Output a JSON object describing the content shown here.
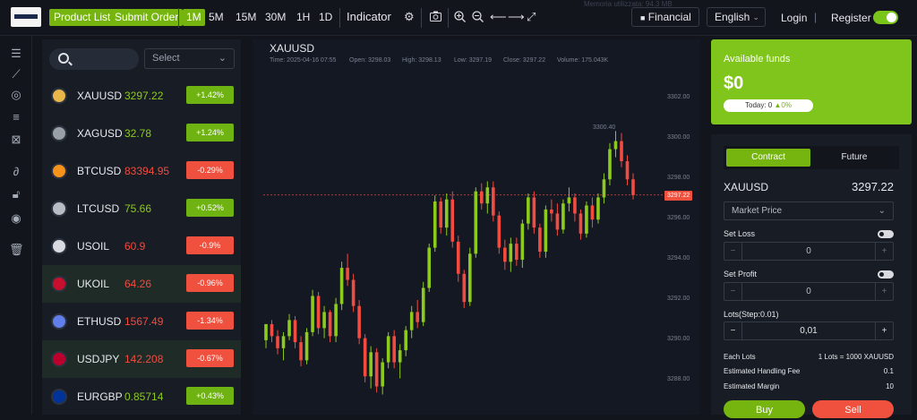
{
  "topbar": {
    "product_list": "Product List",
    "submit_order": "Submit Order",
    "timeframes": [
      "1M",
      "5M",
      "15M",
      "30M",
      "1H",
      "1D"
    ],
    "indicator": "Indicator",
    "memory": "Memoria utilizzata: 94.3 MB",
    "financial": "Financial",
    "language": "English",
    "login": "Login",
    "divider": "|",
    "register": "Register"
  },
  "watchlist": {
    "select_placeholder": "Select",
    "items": [
      {
        "symbol": "XAUUSD",
        "price": "3297.22",
        "change": "+1.42%",
        "dir": "up"
      },
      {
        "symbol": "XAGUSD",
        "price": "32.78",
        "change": "+1.24%",
        "dir": "up"
      },
      {
        "symbol": "BTCUSD",
        "price": "83394.95",
        "change": "-0.29%",
        "dir": "dn"
      },
      {
        "symbol": "LTCUSD",
        "price": "75.66",
        "change": "+0.52%",
        "dir": "up"
      },
      {
        "symbol": "USOIL",
        "price": "60.9",
        "change": "-0.9%",
        "dir": "dn"
      },
      {
        "symbol": "UKOIL",
        "price": "64.26",
        "change": "-0.96%",
        "dir": "dn"
      },
      {
        "symbol": "ETHUSD",
        "price": "1567.49",
        "change": "-1.34%",
        "dir": "dn"
      },
      {
        "symbol": "USDJPY",
        "price": "142.208",
        "change": "-0.67%",
        "dir": "dn"
      },
      {
        "symbol": "EURGBP",
        "price": "0.85714",
        "change": "+0.43%",
        "dir": "up"
      }
    ]
  },
  "chart": {
    "symbol": "XAUUSD",
    "time": "Time: 2025-04-16 07:55",
    "open": "Open: 3298.03",
    "high": "High: 3298.13",
    "low": "Low: 3297.19",
    "close": "Close: 3297.22",
    "volume": "Volume: 175.043K",
    "axis": [
      "3302.00",
      "3300.00",
      "3298.00",
      "3296.00",
      "3294.00",
      "3292.00",
      "3290.00",
      "3288.00"
    ],
    "last_price": "3297.22",
    "high_marker": "3300.40"
  },
  "chart_data": {
    "type": "candlestick",
    "symbol": "XAUUSD",
    "y_ticks": [
      3302,
      3300,
      3298,
      3296,
      3294,
      3292,
      3290,
      3288
    ],
    "ylim": [
      3287.5,
      3303.0
    ],
    "last_price": 3297.22,
    "marked_high": 3300.4,
    "candles": [
      [
        3290,
        3290.8,
        3289.6,
        3290.8
      ],
      [
        3290.8,
        3291.0,
        3289.9,
        3290.2
      ],
      [
        3290.2,
        3290.5,
        3289.3,
        3289.6
      ],
      [
        3289.6,
        3290.4,
        3289.0,
        3290.2
      ],
      [
        3290.2,
        3291.3,
        3290.0,
        3291.0
      ],
      [
        3291.0,
        3291.2,
        3289.6,
        3289.9
      ],
      [
        3289.9,
        3290.2,
        3288.7,
        3289.0
      ],
      [
        3289.0,
        3290.6,
        3288.8,
        3290.4
      ],
      [
        3290.4,
        3292.5,
        3290.2,
        3292.2
      ],
      [
        3292.2,
        3292.4,
        3290.3,
        3290.6
      ],
      [
        3290.6,
        3291.7,
        3290.1,
        3291.4
      ],
      [
        3291.4,
        3291.5,
        3289.9,
        3290.2
      ],
      [
        3290.2,
        3292.1,
        3289.9,
        3291.8
      ],
      [
        3291.8,
        3293.9,
        3291.5,
        3293.6
      ],
      [
        3293.6,
        3294.3,
        3292.7,
        3293.0
      ],
      [
        3293.0,
        3293.3,
        3291.4,
        3291.7
      ],
      [
        3291.7,
        3292.0,
        3289.8,
        3290.1
      ],
      [
        3290.1,
        3290.3,
        3287.9,
        3288.2
      ],
      [
        3288.2,
        3289.7,
        3287.6,
        3289.4
      ],
      [
        3289.4,
        3289.6,
        3287.4,
        3287.7
      ],
      [
        3287.7,
        3289.1,
        3287.3,
        3288.9
      ],
      [
        3288.9,
        3290.4,
        3288.6,
        3290.2
      ],
      [
        3290.2,
        3290.5,
        3288.6,
        3288.9
      ],
      [
        3288.9,
        3289.8,
        3288.1,
        3289.5
      ],
      [
        3289.5,
        3290.7,
        3289.2,
        3290.5
      ],
      [
        3290.5,
        3291.7,
        3290.1,
        3291.4
      ],
      [
        3291.4,
        3292.0,
        3290.6,
        3290.9
      ],
      [
        3290.9,
        3292.9,
        3290.7,
        3292.6
      ],
      [
        3292.6,
        3294.8,
        3292.4,
        3294.6
      ],
      [
        3294.6,
        3297.2,
        3294.4,
        3296.9
      ],
      [
        3296.9,
        3297.1,
        3295.3,
        3295.6
      ],
      [
        3295.6,
        3297.3,
        3295.2,
        3297.0
      ],
      [
        3297.0,
        3297.4,
        3294.6,
        3294.9
      ],
      [
        3294.9,
        3295.2,
        3292.9,
        3293.3
      ],
      [
        3293.3,
        3293.5,
        3291.6,
        3291.9
      ],
      [
        3291.9,
        3294.6,
        3291.7,
        3294.3
      ],
      [
        3294.3,
        3297.6,
        3294.1,
        3297.4
      ],
      [
        3297.4,
        3297.8,
        3296.5,
        3296.8
      ],
      [
        3296.8,
        3297.9,
        3296.3,
        3297.6
      ],
      [
        3297.6,
        3297.9,
        3295.9,
        3296.2
      ],
      [
        3296.2,
        3296.4,
        3294.3,
        3294.6
      ],
      [
        3294.6,
        3295.0,
        3293.5,
        3293.9
      ],
      [
        3293.9,
        3295.1,
        3293.4,
        3294.8
      ],
      [
        3294.8,
        3295.1,
        3293.7,
        3294.0
      ],
      [
        3294.0,
        3296.0,
        3293.6,
        3295.8
      ],
      [
        3295.8,
        3297.3,
        3295.5,
        3297.1
      ],
      [
        3297.1,
        3297.4,
        3295.3,
        3295.6
      ],
      [
        3295.6,
        3295.8,
        3294.1,
        3294.4
      ],
      [
        3294.4,
        3296.7,
        3294.1,
        3296.5
      ],
      [
        3296.5,
        3297.0,
        3295.9,
        3296.3
      ],
      [
        3296.3,
        3296.8,
        3295.2,
        3295.5
      ],
      [
        3295.5,
        3297.0,
        3295.3,
        3296.8
      ],
      [
        3296.8,
        3297.6,
        3296.4,
        3297.1
      ],
      [
        3297.1,
        3297.3,
        3295.9,
        3296.3
      ],
      [
        3296.3,
        3296.5,
        3295.0,
        3295.3
      ],
      [
        3295.3,
        3296.9,
        3295.1,
        3296.7
      ],
      [
        3296.7,
        3297.1,
        3295.6,
        3296.0
      ],
      [
        3296.0,
        3297.3,
        3295.8,
        3297.1
      ],
      [
        3297.1,
        3298.3,
        3296.8,
        3298.0
      ],
      [
        3298.0,
        3299.8,
        3297.7,
        3299.5
      ],
      [
        3299.5,
        3300.4,
        3299.1,
        3299.9
      ],
      [
        3299.9,
        3300.3,
        3298.6,
        3298.9
      ],
      [
        3298.9,
        3299.2,
        3297.7,
        3298.0
      ],
      [
        3298.0,
        3298.3,
        3297.0,
        3297.22
      ]
    ]
  },
  "funds": {
    "title": "Available funds",
    "value": "$0",
    "today": "Today: 0",
    "pct": "0%"
  },
  "trade": {
    "tabs": [
      "Contract",
      "Future"
    ],
    "symbol": "XAUUSD",
    "price": "3297.22",
    "order_type": "Market Price",
    "set_loss": "Set Loss",
    "loss_value": "0",
    "set_profit": "Set Profit",
    "profit_value": "0",
    "lots_label": "Lots(Step:0.01)",
    "lots_value": "0,01",
    "each_lots": "Each Lots",
    "each_lots_value": "1 Lots = 1000 XAUUSD",
    "fee_label": "Estimated Handling Fee",
    "fee_value": "0.1",
    "margin_label": "Estimated Margin",
    "margin_value": "10",
    "buy": "Buy",
    "sell": "Sell"
  },
  "colors": {
    "accent": "#76b50f",
    "up": "#8dca1e",
    "down": "#f24b3f",
    "panel": "#181c24",
    "bg": "#12151c"
  }
}
